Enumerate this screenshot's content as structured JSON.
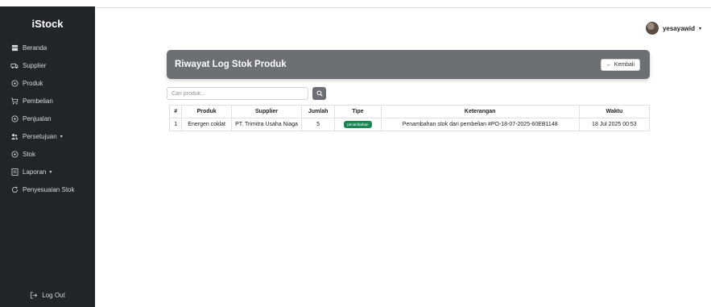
{
  "app": {
    "brand": "iStock"
  },
  "sidebar": {
    "items": [
      {
        "label": "Beranda",
        "icon": "home-icon",
        "caret": ""
      },
      {
        "label": "Supplier",
        "icon": "truck-icon",
        "caret": ""
      },
      {
        "label": "Produk",
        "icon": "tag-icon",
        "caret": ""
      },
      {
        "label": "Pembelian",
        "icon": "cart-icon",
        "caret": ""
      },
      {
        "label": "Penjualan",
        "icon": "tag-icon",
        "caret": ""
      },
      {
        "label": "Persetujuan",
        "icon": "users-icon",
        "caret": "▾"
      },
      {
        "label": "Stok",
        "icon": "box-icon",
        "caret": ""
      },
      {
        "label": "Laporan",
        "icon": "report-icon",
        "caret": "▾"
      },
      {
        "label": "Penyesuaian Stok",
        "icon": "refresh-icon",
        "caret": ""
      }
    ],
    "logout": "Log Out"
  },
  "user": {
    "name": "yesayawid",
    "caret": "▾"
  },
  "page": {
    "title": "Riwayat Log Stok Produk",
    "back_label": "Kembali",
    "back_arrow": "←"
  },
  "search": {
    "placeholder": "Cari produk..."
  },
  "table": {
    "headers": [
      "#",
      "Produk",
      "Supplier",
      "Jumlah",
      "Tipe",
      "Keterangan",
      "Waktu"
    ],
    "rows": [
      {
        "no": "1",
        "produk": "Energen coklat",
        "supplier": "PT. Trimitra Usaha Niaga",
        "jumlah": "5",
        "tipe": "penambahan",
        "keterangan": "Penambahan stok dari pembelian #PO-18-07-2025-60EB1148",
        "waktu": "18 Jul 2025 00:53"
      }
    ]
  },
  "colors": {
    "sidebar_bg": "#212529",
    "header_card_bg": "#6c7075",
    "badge_success": "#198754"
  }
}
